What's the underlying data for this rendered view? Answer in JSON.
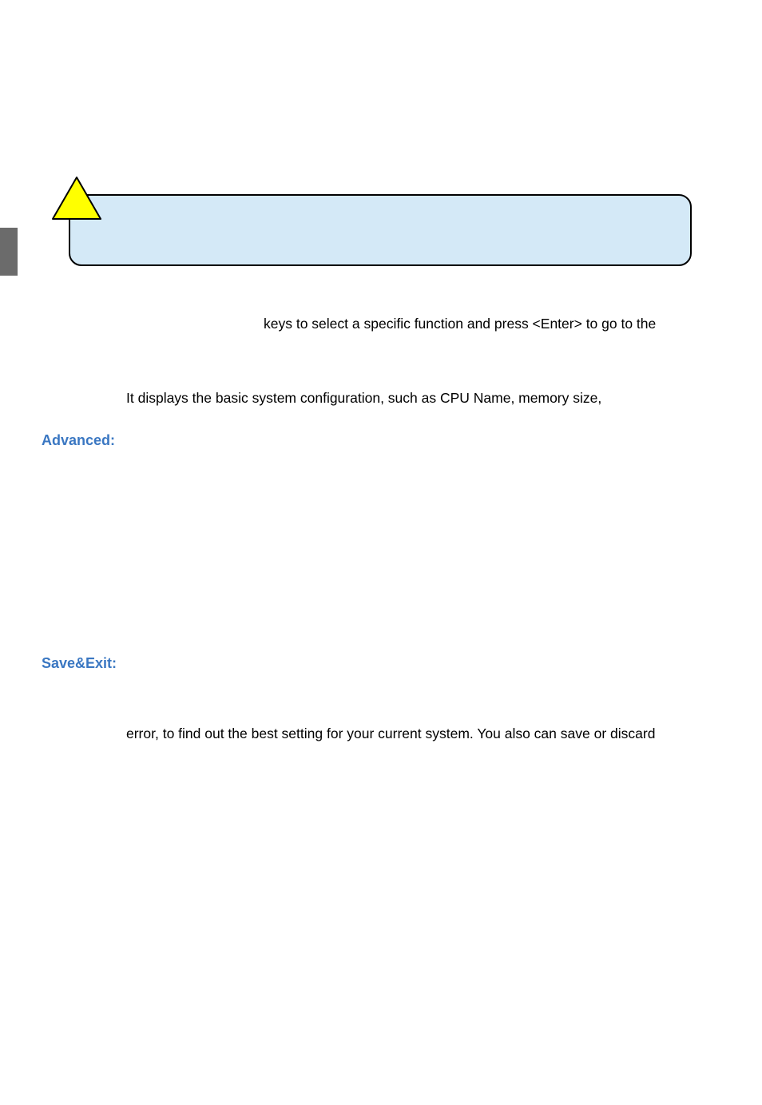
{
  "line1": "keys to select a specific function and press <Enter> to go to the",
  "line2": "It displays the basic system configuration, such as CPU Name, memory size,",
  "headings": {
    "advanced": "Advanced:",
    "saveexit": "Save&Exit:"
  },
  "line3": "error, to find out the best setting for your current system. You also can save or discard"
}
